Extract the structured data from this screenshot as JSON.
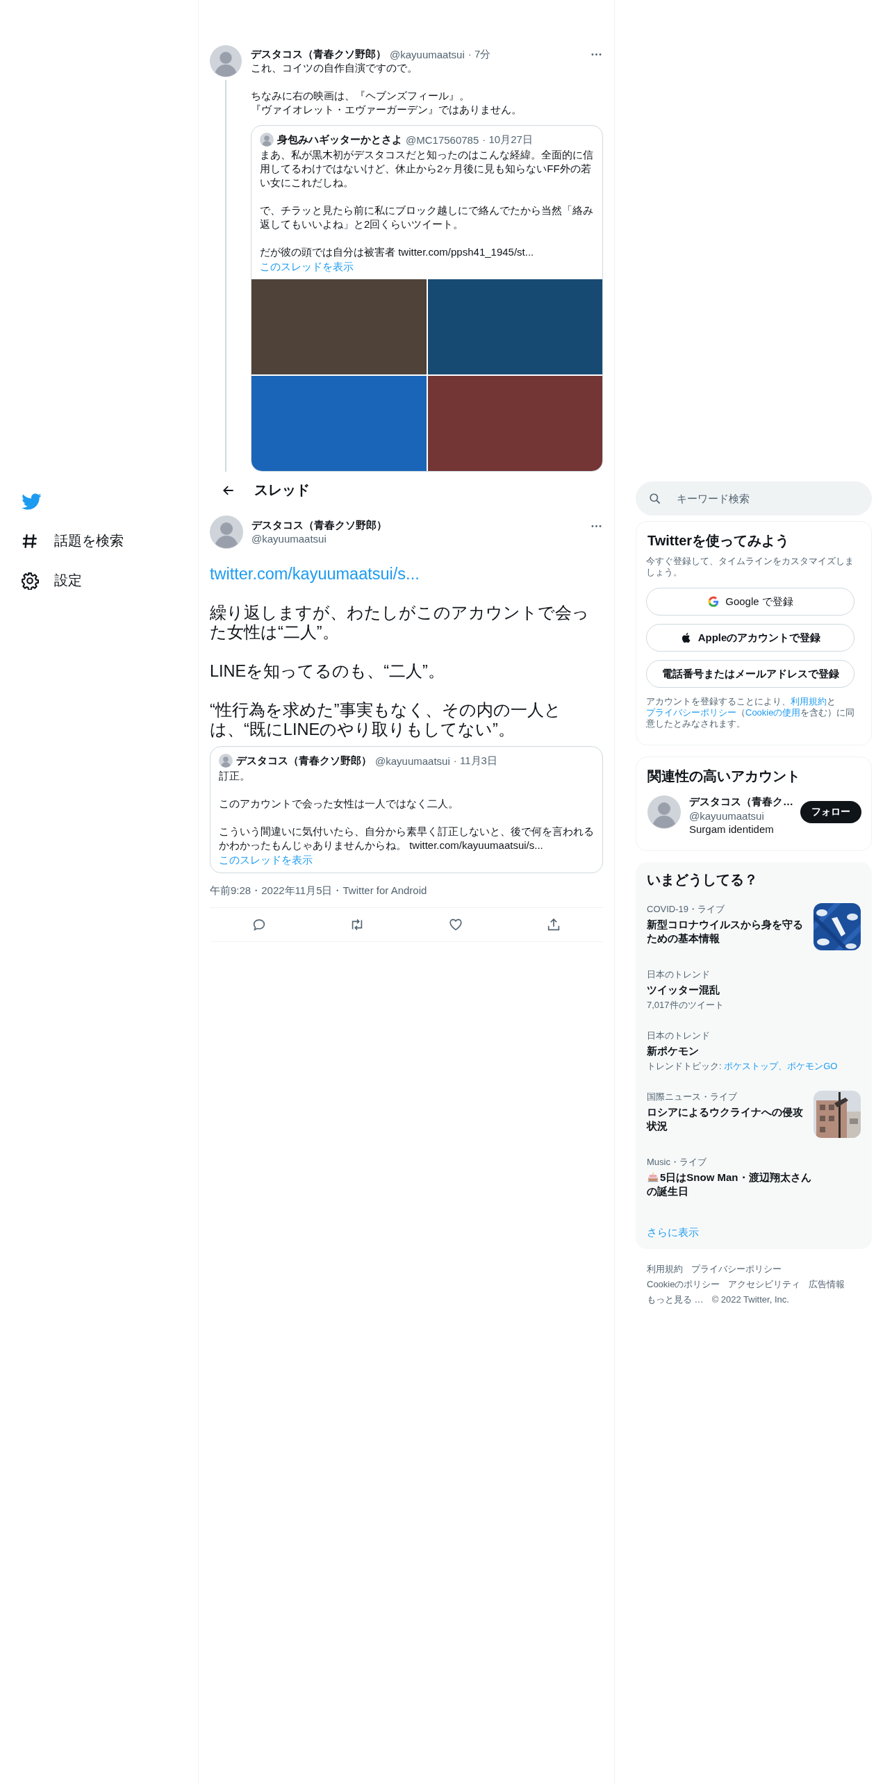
{
  "nav": {
    "items": [
      {
        "kind": "hashtag",
        "label": "話題を検索"
      },
      {
        "kind": "gear",
        "label": "設定"
      }
    ]
  },
  "earlier_tweet": {
    "name": "デスタコス（青春クソ野郎）",
    "handle": "@kayuumaatsui",
    "time": "· 7分",
    "paragraphs": [
      [
        "これ、コイツの自作自演ですので。"
      ],
      [
        "ちなみに右の映画は、『ヘブンズフィール』。",
        "『ヴァイオレット・エヴァーガーデン』ではありません。"
      ]
    ],
    "quote": {
      "name": "身包みハギッターかとさよ",
      "handle": "@MC17560785",
      "time": "· 10月27日",
      "paragraphs": [
        "まあ、私が黒木初がデスタコスだと知ったのはこんな経緯。全面的に信用してるわけではないけど、休止から2ヶ月後に見も知らないFF外の若い女にこれだしね。",
        "で、チラッと見たら前に私にブロック越しにで絡んでたから当然「絡み返してもいいよね」と2回くらいツイート。",
        "だが彼の頭では自分は被害者 "
      ],
      "link": "twitter.com/ppsh41_1945/st...",
      "show_thread": "このスレッドを表示",
      "media": [
        {
          "color": "#4e4239"
        },
        {
          "color": "#174a72"
        },
        {
          "color": "#1a65b8"
        },
        {
          "color": "#743535"
        }
      ]
    }
  },
  "header": {
    "title": "スレッド"
  },
  "tweet": {
    "name": "デスタコス（青春クソ野郎）",
    "handle": "@kayuumaatsui",
    "link": "twitter.com/kayuumaatsui/s...",
    "paragraphs": [
      "繰り返しますが、わたしがこのアカウントで会った女性は“二人”。",
      "LINEを知ってるのも、“二人”。",
      "“性行為を求めた”事実もなく、その内の一人とは、“既にLINEのやり取りもしてない”。"
    ],
    "quote": {
      "name": "デスタコス（青春クソ野郎）",
      "handle": "@kayuumaatsui",
      "time": "· 11月3日",
      "paragraphs": [
        "訂正。",
        "このアカウントで会った女性は一人ではなく二人。",
        "こういう間違いに気付いたら、自分から素早く訂正しないと、後で何を言われるかわかったもんじゃありませんからね。 "
      ],
      "link": "twitter.com/kayuumaatsui/s...",
      "show_thread": "このスレッドを表示"
    },
    "meta": "午前9:28・2022年11月5日・Twitter for Android",
    "actions": [
      {
        "kind": "reply"
      },
      {
        "kind": "retweet"
      },
      {
        "kind": "like"
      },
      {
        "kind": "share"
      }
    ]
  },
  "search": {
    "placeholder": "キーワード検索"
  },
  "signup": {
    "title": "Twitterを使ってみよう",
    "subtitle": "今すぐ登録して、タイムラインをカスタマイズしましょう。",
    "buttons": [
      {
        "kind": "google",
        "label": "Google で登録"
      },
      {
        "kind": "apple",
        "label": "Appleのアカウントで登録"
      },
      {
        "kind": "plain",
        "label": "電話番号またはメールアドレスで登録"
      }
    ],
    "legal": [
      {
        "kind": "text",
        "text": "アカウントを登録することにより、"
      },
      {
        "kind": "link",
        "text": "利用規約"
      },
      {
        "kind": "text",
        "text": "と"
      },
      {
        "kind": "link",
        "text": "プライバシーポリシー"
      },
      {
        "kind": "text",
        "text": "（"
      },
      {
        "kind": "link",
        "text": "Cookieの使用"
      },
      {
        "kind": "text",
        "text": "を含む）に同意したとみなされます。"
      }
    ]
  },
  "related": {
    "title": "関連性の高いアカウント",
    "account": {
      "name": "デスタコス（青春ク…",
      "handle": "@kayuumaatsui",
      "bio": "Surgam identidem",
      "follow": "フォロー"
    }
  },
  "trends": {
    "title": "いまどうしてる？",
    "items": [
      {
        "kind": "picture",
        "context": "COVID-19・ライブ",
        "title": "新型コロナウイルスから身を守るための基本情報"
      },
      {
        "kind": "count",
        "context": "日本のトレンド",
        "title": "ツイッター混乱",
        "count": "7,017件のツイート"
      },
      {
        "kind": "topics",
        "context": "日本のトレンド",
        "title": "新ポケモン",
        "topics_label": "トレンドトピック:",
        "topics": "ポケストップ、ポケモンGO"
      },
      {
        "kind": "picture",
        "context": "国際ニュース・ライブ",
        "title": "ロシアによるウクライナへの侵攻状況"
      },
      {
        "kind": "emoji",
        "context": "Music・ライブ",
        "title": "5日はSnow Man・渡辺翔太さんの誕生日"
      }
    ],
    "show_more": "さらに表示"
  },
  "footer": {
    "links": [
      "利用規約",
      "プライバシーポリシー",
      "Cookieのポリシー",
      "アクセシビリティ",
      "広告情報",
      "もっと見る …",
      "© 2022 Twitter, Inc."
    ]
  }
}
